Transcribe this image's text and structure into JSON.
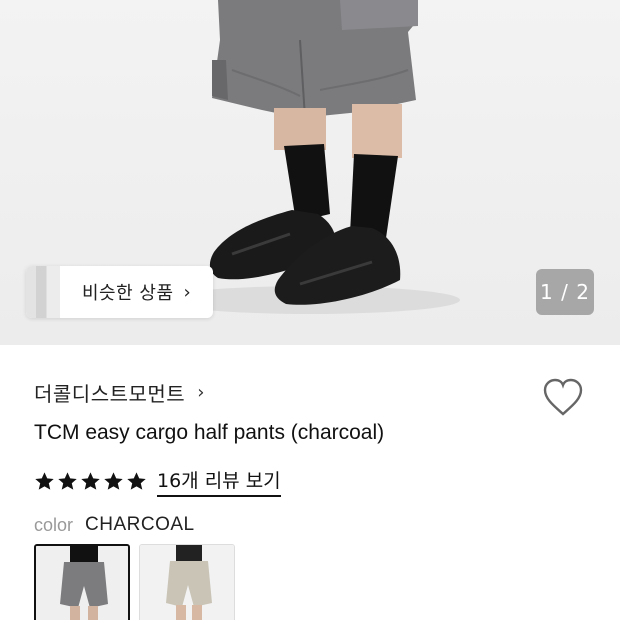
{
  "gallery": {
    "similar_label": "비슷한 상품",
    "page_indicator": "1 / 2"
  },
  "product": {
    "brand": "더콜디스트모먼트",
    "title": "TCM easy cargo half pants (charcoal)",
    "rating": 5,
    "review_link": "16개 리뷰 보기",
    "color_label": "color",
    "color_value": "CHARCOAL"
  },
  "colors": {
    "selected_border": "#111111",
    "star": "#111111"
  }
}
